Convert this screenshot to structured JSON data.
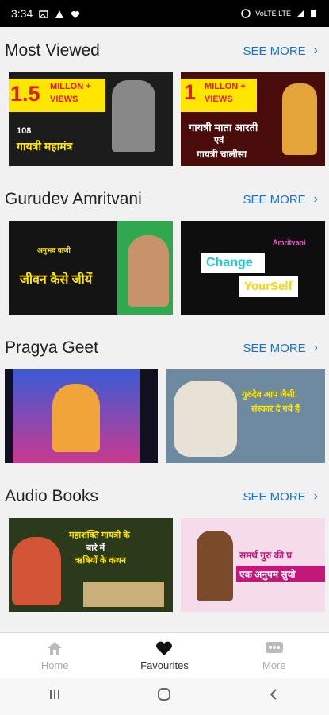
{
  "status": {
    "time": "3:34",
    "network": "VoLTE LTE"
  },
  "sections": [
    {
      "title": "Most Viewed",
      "see_more": "SEE MORE"
    },
    {
      "title": "Gurudev Amritvani",
      "see_more": "SEE MORE"
    },
    {
      "title": "Pragya Geet",
      "see_more": "SEE MORE"
    },
    {
      "title": "Audio Books",
      "see_more": "SEE MORE"
    }
  ],
  "thumbs": {
    "mv1": {
      "badge1": "1.5",
      "badge2": "MILLON +",
      "badge3": "VIEWS",
      "text1": "108",
      "text2": "गायत्री महामंत्र"
    },
    "mv2": {
      "badge1": "1",
      "badge2": "MILLON +",
      "badge3": "VIEWS",
      "text1": "गायत्री माता आरती",
      "text2": "एवं",
      "text3": "गायत्री चालीसा"
    },
    "ga1": {
      "text1": "अनुभव वाणी",
      "text2": "जीवन कैसे जीयें"
    },
    "ga2": {
      "text1": "Change",
      "text2": "YourSelf",
      "text3": "Amritvani"
    },
    "pg2": {
      "text1": "गुरुदेव आप जैसी,",
      "text2": "संस्कार दे गये हैं"
    },
    "ab1": {
      "text1": "महाशक्ति गायत्री के",
      "text2": "बारे में",
      "text3": "ऋषियों के कथन"
    },
    "ab2": {
      "text1": "समर्थ गुरु की प्र",
      "text2": "एक अनुपम सुयो"
    }
  },
  "nav": {
    "home": "Home",
    "favourites": "Favourites",
    "more": "More"
  },
  "colors": {
    "accent": "#1a73c7",
    "badge_yellow": "#ffe600",
    "badge_red": "#e31b23"
  }
}
